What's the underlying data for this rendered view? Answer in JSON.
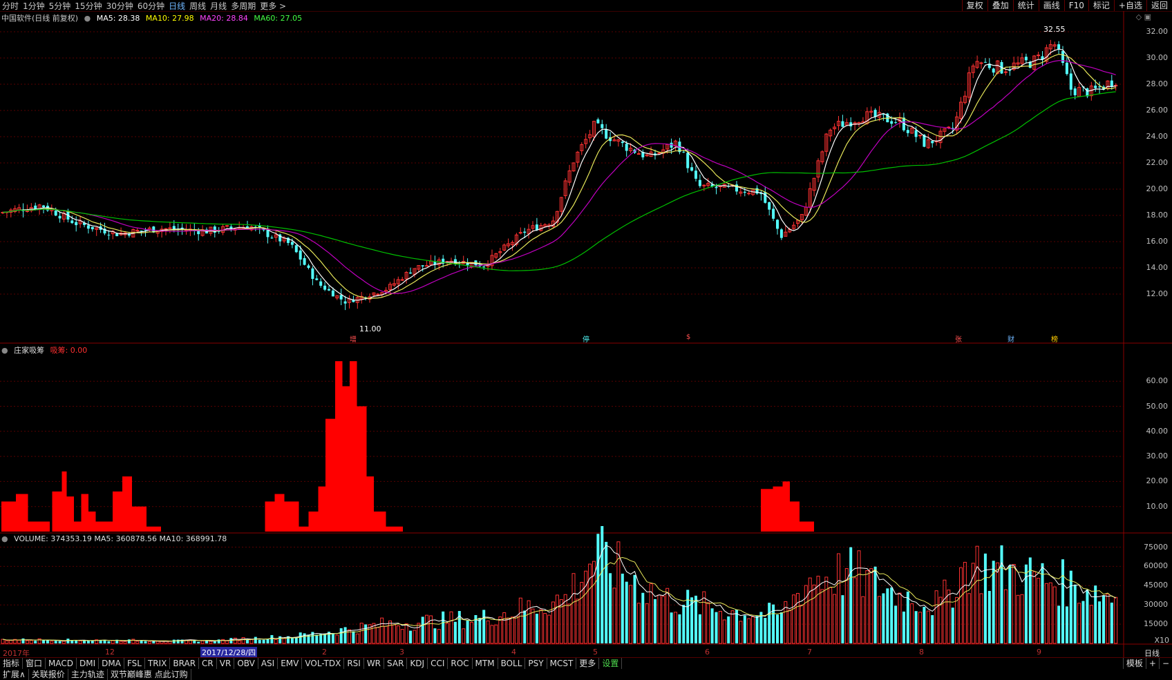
{
  "topbar": {
    "periods": [
      "分时",
      "1分钟",
      "5分钟",
      "15分钟",
      "30分钟",
      "60分钟",
      "日线",
      "周线",
      "月线",
      "多周期",
      "更多 >"
    ],
    "active_period": "日线",
    "right_buttons": [
      "复权",
      "叠加",
      "统计",
      "画线",
      "F10",
      "标记",
      "+自选",
      "返回"
    ]
  },
  "price_panel": {
    "title": "中国软件(日线 前复权)",
    "ma5": "MA5: 28.38",
    "ma10": "MA10: 27.98",
    "ma20": "MA20: 28.84",
    "ma60": "MA60: 27.05",
    "y_ticks": [
      "32.00",
      "30.00",
      "28.00",
      "26.00",
      "24.00",
      "22.00",
      "20.00",
      "18.00",
      "16.00",
      "14.00",
      "12.00"
    ],
    "high_label": "32.55",
    "low_label": "11.00",
    "markers": [
      "增",
      "停",
      "$",
      "张",
      "财",
      "榜"
    ]
  },
  "indicator_panel": {
    "title": "庄家吸筹",
    "value": "吸筹: 0.00",
    "y_ticks": [
      "60.00",
      "50.00",
      "40.00",
      "30.00",
      "20.00",
      "10.00"
    ]
  },
  "volume_panel": {
    "title": "VOLUME: 374353.19  MA5: 360878.56  MA10: 368991.78",
    "y_ticks": [
      "75000",
      "60000",
      "45000",
      "30000",
      "15000"
    ],
    "unit": "X10"
  },
  "date_axis": {
    "labels": [
      "2017年",
      "12",
      "2",
      "3",
      "4",
      "5",
      "6",
      "7",
      "8",
      "9"
    ],
    "selected": "2017/12/28/四",
    "period_label": "日线"
  },
  "bottom_tabs": [
    "指标",
    "窗口",
    "MACD",
    "DMI",
    "DMA",
    "FSL",
    "TRIX",
    "BRAR",
    "CR",
    "VR",
    "OBV",
    "ASI",
    "EMV",
    "VOL-TDX",
    "RSI",
    "WR",
    "SAR",
    "KDJ",
    "CCI",
    "ROC",
    "MTM",
    "BOLL",
    "PSY",
    "MCST",
    "更多",
    "设置"
  ],
  "bottom_right": [
    "模板",
    "+",
    "−"
  ],
  "status_bar": [
    "扩展∧",
    "关联报价",
    "主力轨迹",
    "双节巅峰惠 点此订购"
  ],
  "colors": {
    "up": "#ff3232",
    "down": "#54ffff",
    "ma5": "#ffffff",
    "ma10": "#ffff00",
    "ma20": "#ff00ff",
    "ma60": "#00ff00",
    "grid": "#5a0000"
  }
}
